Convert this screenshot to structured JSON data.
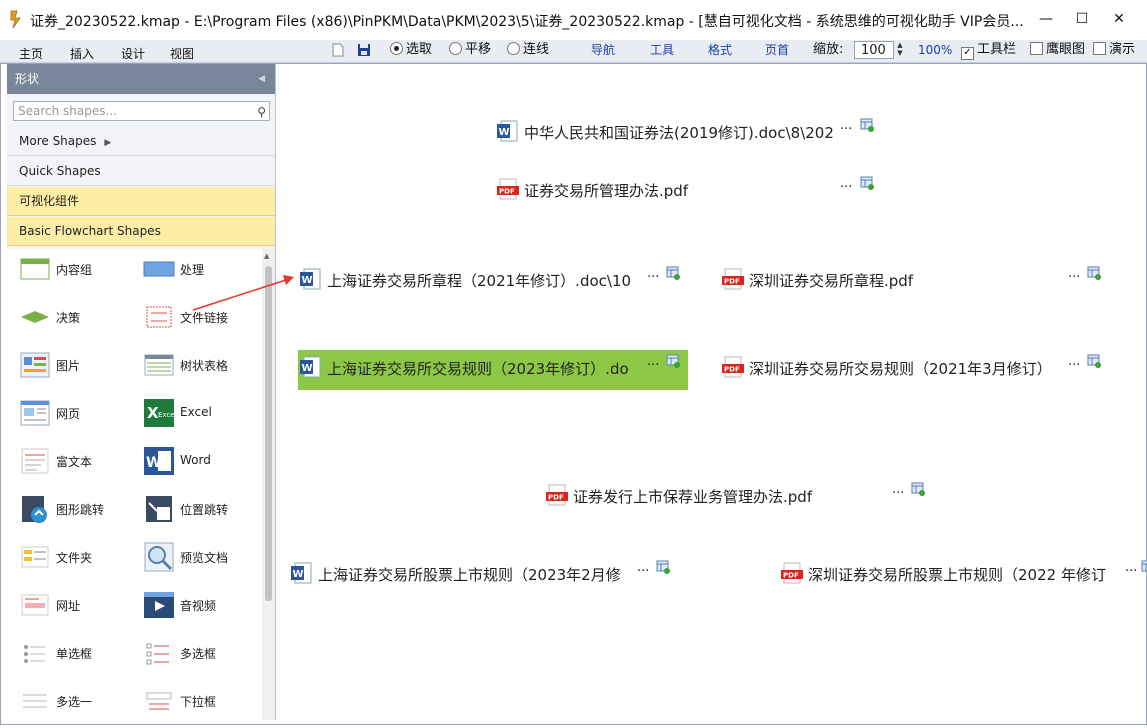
{
  "window": {
    "title": "证券_20230522.kmap -  E:\\Program Files (x86)\\PinPKM\\Data\\PKM\\2023\\5\\证券_20230522.kmap - [慧自可视化文档 - 系统思维的可视化助手 VIP会员...",
    "minimize": "—",
    "maximize": "☐",
    "close": "✕"
  },
  "menu": [
    "主页",
    "插入",
    "设计",
    "视图"
  ],
  "toolbar": {
    "modes": [
      {
        "label": "选取",
        "selected": true
      },
      {
        "label": "平移",
        "selected": false
      },
      {
        "label": "连线",
        "selected": false
      }
    ],
    "links": [
      "导航",
      "工具",
      "格式",
      "页首"
    ],
    "zoom_label": "缩放:",
    "zoom_value": "100",
    "zoom_percent": "100%",
    "checks": [
      {
        "label": "工具栏",
        "checked": true
      },
      {
        "label": "鹰眼图",
        "checked": false
      },
      {
        "label": "演示",
        "checked": false
      }
    ]
  },
  "sidebar": {
    "title": "形状",
    "search_placeholder": "Search shapes...",
    "categories": [
      {
        "label": "More Shapes",
        "highlight": false
      },
      {
        "label": "Quick Shapes",
        "highlight": false
      },
      {
        "label": "可视化组件",
        "highlight": true
      },
      {
        "label": "Basic Flowchart Shapes",
        "highlight": true
      }
    ],
    "shapes": [
      {
        "label": "内容组",
        "icon": "content-group-icon"
      },
      {
        "label": "处理",
        "icon": "process-icon"
      },
      {
        "label": "决策",
        "icon": "decision-icon"
      },
      {
        "label": "文件链接",
        "icon": "file-link-icon"
      },
      {
        "label": "图片",
        "icon": "picture-icon"
      },
      {
        "label": "树状表格",
        "icon": "tree-table-icon"
      },
      {
        "label": "网页",
        "icon": "webpage-icon"
      },
      {
        "label": "Excel",
        "icon": "excel-icon"
      },
      {
        "label": "富文本",
        "icon": "rich-text-icon"
      },
      {
        "label": "Word",
        "icon": "word-icon"
      },
      {
        "label": "图形跳转",
        "icon": "shape-jump-icon"
      },
      {
        "label": "位置跳转",
        "icon": "position-jump-icon"
      },
      {
        "label": "文件夹",
        "icon": "folder-icon"
      },
      {
        "label": "预览文档",
        "icon": "preview-doc-icon"
      },
      {
        "label": "网址",
        "icon": "url-icon"
      },
      {
        "label": "音视频",
        "icon": "media-icon"
      },
      {
        "label": "单选框",
        "icon": "radio-box-icon"
      },
      {
        "label": "多选框",
        "icon": "checkbox-icon"
      },
      {
        "label": "多选一",
        "icon": "multi-select-one-icon"
      },
      {
        "label": "下拉框",
        "icon": "dropdown-icon"
      }
    ]
  },
  "canvas": {
    "nodes": [
      {
        "label": "中华人民共和国证券法(2019修订).doc\\8\\202",
        "type": "word",
        "selected": false
      },
      {
        "label": "证券交易所管理办法.pdf",
        "type": "pdf",
        "selected": false
      },
      {
        "label": "上海证券交易所章程（2021年修订）.doc\\10",
        "type": "word",
        "selected": false
      },
      {
        "label": "深圳证券交易所章程.pdf",
        "type": "pdf",
        "selected": false
      },
      {
        "label": "上海证券交易所交易规则（2023年修订）.do",
        "type": "word",
        "selected": true
      },
      {
        "label": "深圳证券交易所交易规则（2021年3月修订）",
        "type": "pdf",
        "selected": false
      },
      {
        "label": "证券发行上市保荐业务管理办法.pdf",
        "type": "pdf",
        "selected": false
      },
      {
        "label": "上海证券交易所股票上市规则（2023年2月修",
        "type": "word",
        "selected": false
      },
      {
        "label": "深圳证券交易所股票上市规则（2022 年修订",
        "type": "pdf",
        "selected": false
      }
    ],
    "more": "···",
    "pdf_badge": "PDF",
    "word_badge": "W",
    "colors": {
      "selected_bg": "#8cc846",
      "arrow": "#e8352a",
      "pdf": "#d9261c",
      "word": "#2b579a"
    }
  }
}
